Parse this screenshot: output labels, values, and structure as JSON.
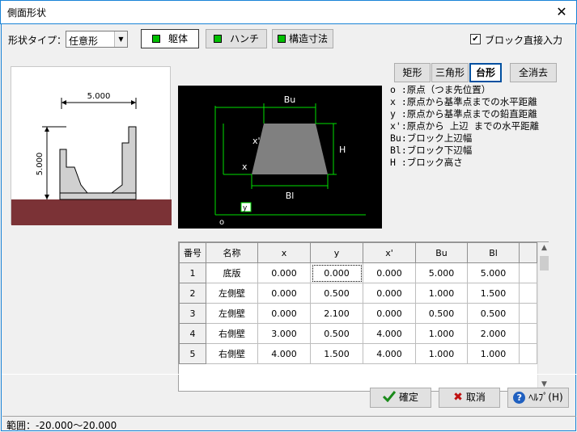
{
  "window": {
    "title": "側面形状",
    "close": "✕"
  },
  "toolbar": {
    "shape_type_label": "形状タイプ：",
    "shape_type_value": "任意形",
    "btn_body": "躯体",
    "btn_haunch": "ハンチ",
    "btn_dims": "構造寸法",
    "block_direct_input": "ブロック直接入力",
    "block_direct_checked": true
  },
  "shape_buttons": {
    "rect": "矩形",
    "triangle": "三角形",
    "trapezoid": "台形",
    "clear_all": "全消去"
  },
  "preview": {
    "width_label": "5.000",
    "height_label": "5.000"
  },
  "figure": {
    "bu": "Bu",
    "bl": "Bl",
    "h": "H",
    "xprime": "x'",
    "x": "x",
    "y": "y",
    "o": "o"
  },
  "legend": [
    "o :原点（つま先位置）",
    "x :原点から基準点までの水平距離",
    "y :原点から基準点までの鉛直距離",
    "x':原点から 上辺 までの水平距離",
    "Bu:ブロック上辺幅",
    "Bl:ブロック下辺幅",
    "H :ブロック高さ"
  ],
  "table": {
    "headers": [
      "番号",
      "名称",
      "x",
      "y",
      "x'",
      "Bu",
      "Bl"
    ],
    "rows": [
      [
        "1",
        "底版",
        "0.000",
        "0.000",
        "0.000",
        "5.000",
        "5.000"
      ],
      [
        "2",
        "左側壁",
        "0.000",
        "0.500",
        "0.000",
        "1.000",
        "1.500"
      ],
      [
        "3",
        "左側壁",
        "0.000",
        "2.100",
        "0.000",
        "0.500",
        "0.500"
      ],
      [
        "4",
        "右側壁",
        "3.000",
        "0.500",
        "4.000",
        "1.000",
        "2.000"
      ],
      [
        "5",
        "右側壁",
        "4.000",
        "1.500",
        "4.000",
        "1.000",
        "1.000"
      ]
    ]
  },
  "footer": {
    "ok": "確定",
    "cancel": "取消",
    "help": "ﾍﾙﾌﾟ(H)"
  },
  "status": {
    "range": "範囲：-20.000～20.000"
  },
  "colors": {
    "ground": "#7b3236",
    "figure_line": "#00e000",
    "green_sq": "#00c000",
    "active_border": "#0050a0"
  }
}
